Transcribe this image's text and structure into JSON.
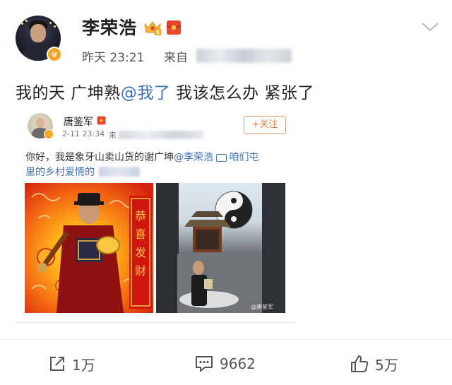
{
  "post": {
    "username": "李荣浩",
    "time": "昨天 23:21",
    "source_label": "来自",
    "text_before": "我的天 广坤熟",
    "mention": "@我了",
    "text_after": " 我该怎么办 紧张了"
  },
  "repost": {
    "username": "唐鉴军",
    "time": "2-11 23:34",
    "source_label": "来",
    "follow_label": "+关注",
    "text_line1_before": "你好，我是象牙山卖山货的谢广坤",
    "text_line1_mention": "@李荣浩",
    "text_line1_link": "咱们屯",
    "text_line2": "里的乡村爱情的",
    "photo_watermark": "@唐鉴军",
    "poster_text": "恭喜发财"
  },
  "actions": {
    "share_count": "1万",
    "comment_count": "9662",
    "like_count": "5万"
  },
  "colors": {
    "link": "#3b6fb6",
    "follow": "#e07c3a",
    "badge": "#f5a623"
  },
  "icons": [
    "crown-icon",
    "red-packet-icon",
    "chevron-down-icon",
    "share-icon",
    "comment-icon",
    "thumbs-up-icon",
    "link-icon",
    "verified-badge-icon"
  ]
}
